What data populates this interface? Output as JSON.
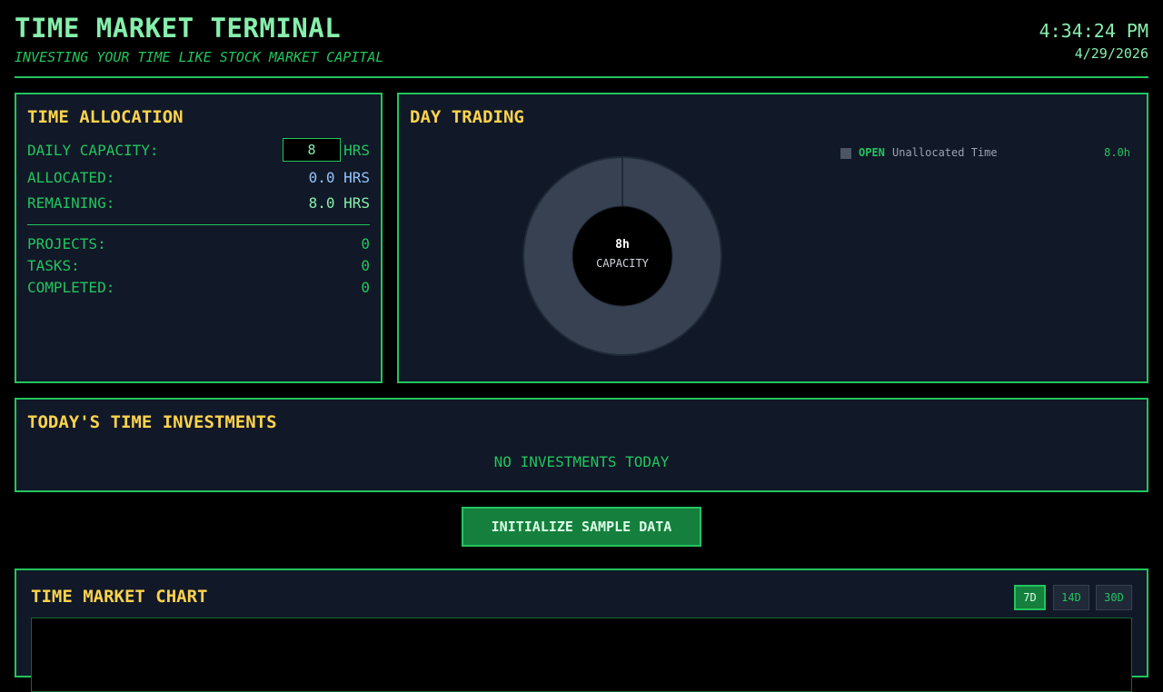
{
  "header": {
    "title": "TIME MARKET TERMINAL",
    "subtitle": "INVESTING YOUR TIME LIKE STOCK MARKET CAPITAL",
    "time": "4:34:24 PM",
    "date": "4/29/2026"
  },
  "allocation": {
    "title": "TIME ALLOCATION",
    "capacity_label": "DAILY CAPACITY:",
    "capacity_value": "8",
    "capacity_unit": "HRS",
    "allocated_label": "ALLOCATED:",
    "allocated_value": "0.0 HRS",
    "remaining_label": "REMAINING:",
    "remaining_value": "8.0 HRS",
    "projects_label": "PROJECTS:",
    "projects_value": "0",
    "tasks_label": "TASKS:",
    "tasks_value": "0",
    "completed_label": "COMPLETED:",
    "completed_value": "0"
  },
  "trading": {
    "title": "DAY TRADING",
    "center_value": "8h",
    "center_label": "CAPACITY",
    "legend": [
      {
        "status": "OPEN",
        "label": "Unallocated Time",
        "value": "8.0h"
      }
    ],
    "donut_fill_color": "#374151"
  },
  "investments": {
    "title": "TODAY'S TIME INVESTMENTS",
    "empty": "NO INVESTMENTS TODAY"
  },
  "actions": {
    "init_label": "INITIALIZE SAMPLE DATA"
  },
  "market_chart": {
    "title": "TIME MARKET CHART",
    "ranges": [
      "7D",
      "14D",
      "30D"
    ],
    "active_range": "7D"
  },
  "colors": {
    "accent": "#22c55e",
    "title": "#fcd34d",
    "panel": "#111827",
    "background": "#000000"
  }
}
